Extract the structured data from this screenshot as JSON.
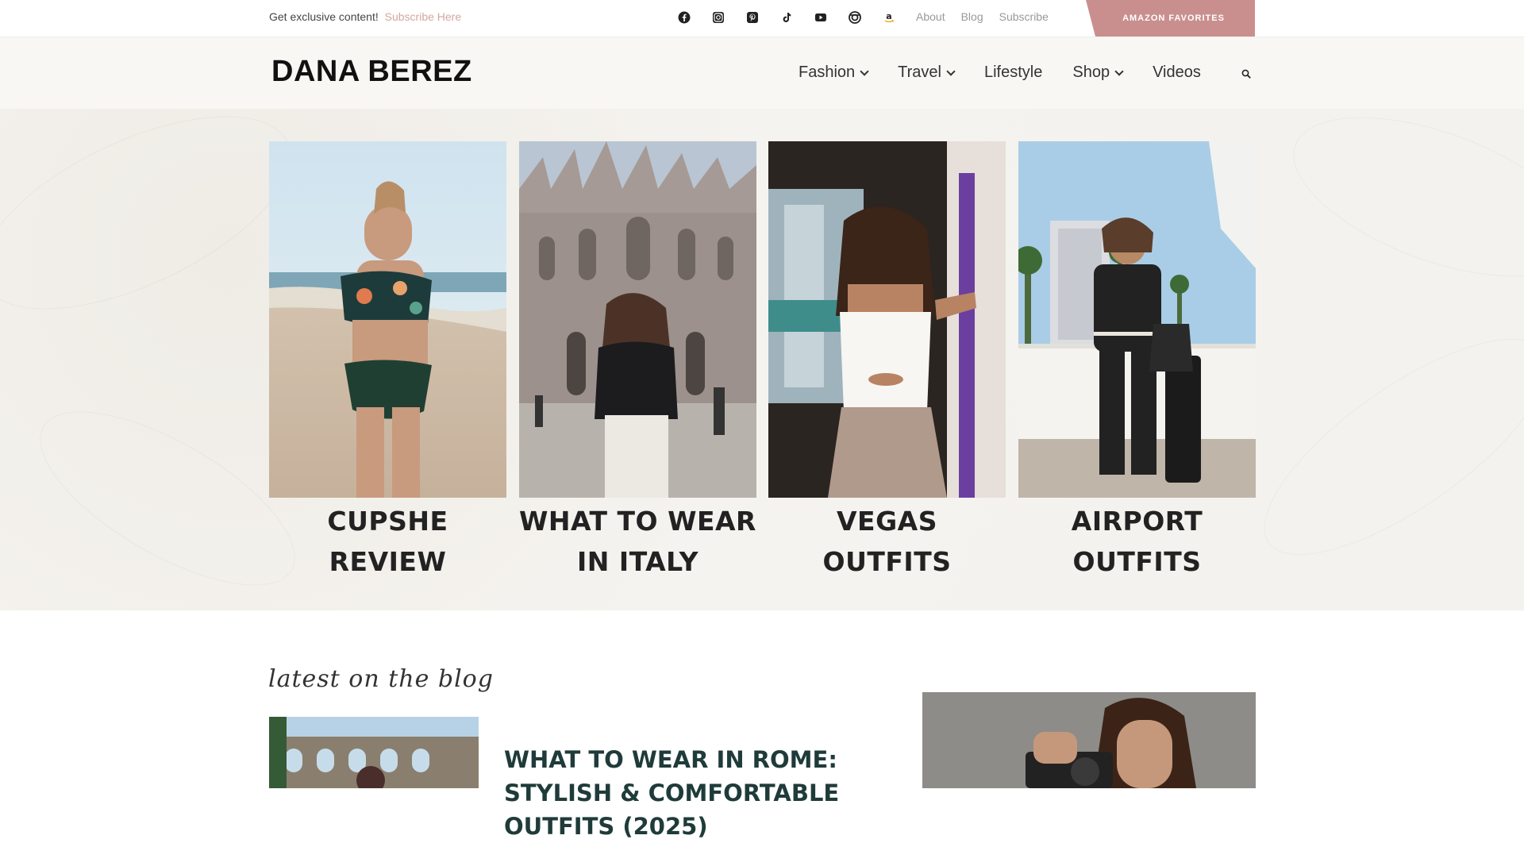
{
  "topbar": {
    "promo_text": "Get exclusive content!",
    "promo_link": "Subscribe Here",
    "social_icons": [
      "facebook-icon",
      "instagram-icon",
      "pinterest-icon",
      "tiktok-icon",
      "youtube-icon",
      "ltk-icon",
      "amazon-icon"
    ],
    "links": [
      "About",
      "Blog",
      "Subscribe"
    ],
    "cta": "AMAZON FAVORITES"
  },
  "header": {
    "logo": "DANA BEREZ",
    "nav": [
      {
        "label": "Fashion",
        "has_dropdown": true
      },
      {
        "label": "Travel",
        "has_dropdown": true
      },
      {
        "label": "Lifestyle",
        "has_dropdown": false
      },
      {
        "label": "Shop",
        "has_dropdown": true
      },
      {
        "label": "Videos",
        "has_dropdown": false
      }
    ]
  },
  "featured": [
    {
      "title": "CUPSHE REVIEW"
    },
    {
      "title": "WHAT TO WEAR IN ITALY"
    },
    {
      "title": "VEGAS OUTFITS"
    },
    {
      "title": "AIRPORT OUTFITS"
    }
  ],
  "blog": {
    "heading": "latest on the blog",
    "post_title": "WHAT TO WEAR IN ROME: STYLISH & COMFORTABLE OUTFITS (2025)"
  },
  "colors": {
    "accent": "#c98f8e",
    "link": "#d3a69f",
    "post_title": "#1f3b3a"
  }
}
